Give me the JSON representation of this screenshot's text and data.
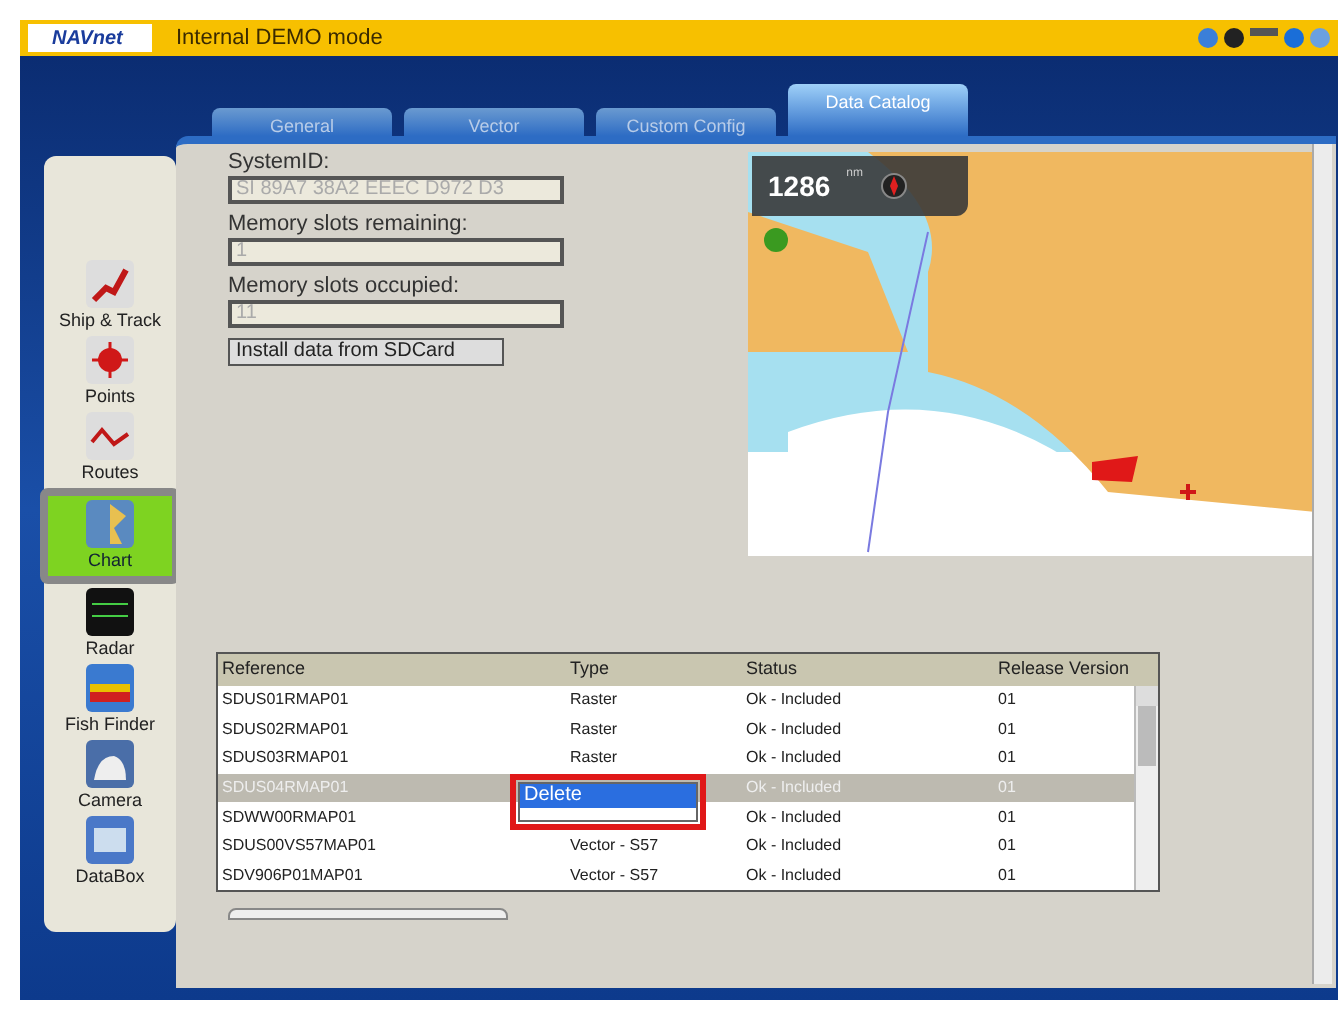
{
  "window": {
    "logo": "NAVnet",
    "title": "Internal DEMO mode"
  },
  "tabs": [
    {
      "label": "General",
      "selected": false
    },
    {
      "label": "Vector",
      "selected": false
    },
    {
      "label": "Custom Config",
      "selected": false
    },
    {
      "label": "Data Catalog",
      "selected": true
    }
  ],
  "sidebar": {
    "items": [
      {
        "label": "Ship & Track",
        "kind": "track",
        "selected": false
      },
      {
        "label": "Points",
        "kind": "points",
        "selected": false
      },
      {
        "label": "Routes",
        "kind": "routes",
        "selected": false
      },
      {
        "label": "Chart",
        "kind": "chart",
        "selected": true
      },
      {
        "label": "Radar",
        "kind": "radar",
        "selected": false
      },
      {
        "label": "Fish Finder",
        "kind": "fish",
        "selected": false
      },
      {
        "label": "Camera",
        "kind": "camera",
        "selected": false
      },
      {
        "label": "DataBox",
        "kind": "databox",
        "selected": false
      }
    ]
  },
  "fields": [
    {
      "label": "SystemID:",
      "value": "SI 89A7 38A2 EEEC D972 D3"
    },
    {
      "label": "Memory slots remaining:",
      "value": "1"
    },
    {
      "label": "Memory slots occupied:",
      "value": "11"
    }
  ],
  "install_button": "Install data from SDCard",
  "map": {
    "range": "1286",
    "unit": "nm"
  },
  "table": {
    "columns": [
      "Reference",
      "Type",
      "Status",
      "Release Version"
    ],
    "rows": [
      {
        "cells": [
          "SDUS01RMAP01",
          "Raster",
          "Ok - Included",
          "01"
        ],
        "selected": false
      },
      {
        "cells": [
          "SDUS02RMAP01",
          "Raster",
          "Ok - Included",
          "01"
        ],
        "selected": false
      },
      {
        "cells": [
          "SDUS03RMAP01",
          "Raster",
          "Ok - Included",
          "01"
        ],
        "selected": false
      },
      {
        "cells": [
          "SDUS04RMAP01",
          "",
          "Ok - Included",
          "01"
        ],
        "selected": true
      },
      {
        "cells": [
          "SDWW00RMAP01",
          "",
          "Ok - Included",
          "01"
        ],
        "selected": false
      },
      {
        "cells": [
          "SDUS00VS57MAP01",
          "Vector - S57",
          "Ok - Included",
          "01"
        ],
        "selected": false
      },
      {
        "cells": [
          "SDV906P01MAP01",
          "Vector - S57",
          "Ok - Included",
          "01"
        ],
        "selected": false
      }
    ]
  },
  "context_menu": {
    "items": [
      {
        "label": "Delete",
        "selected": true
      }
    ]
  }
}
